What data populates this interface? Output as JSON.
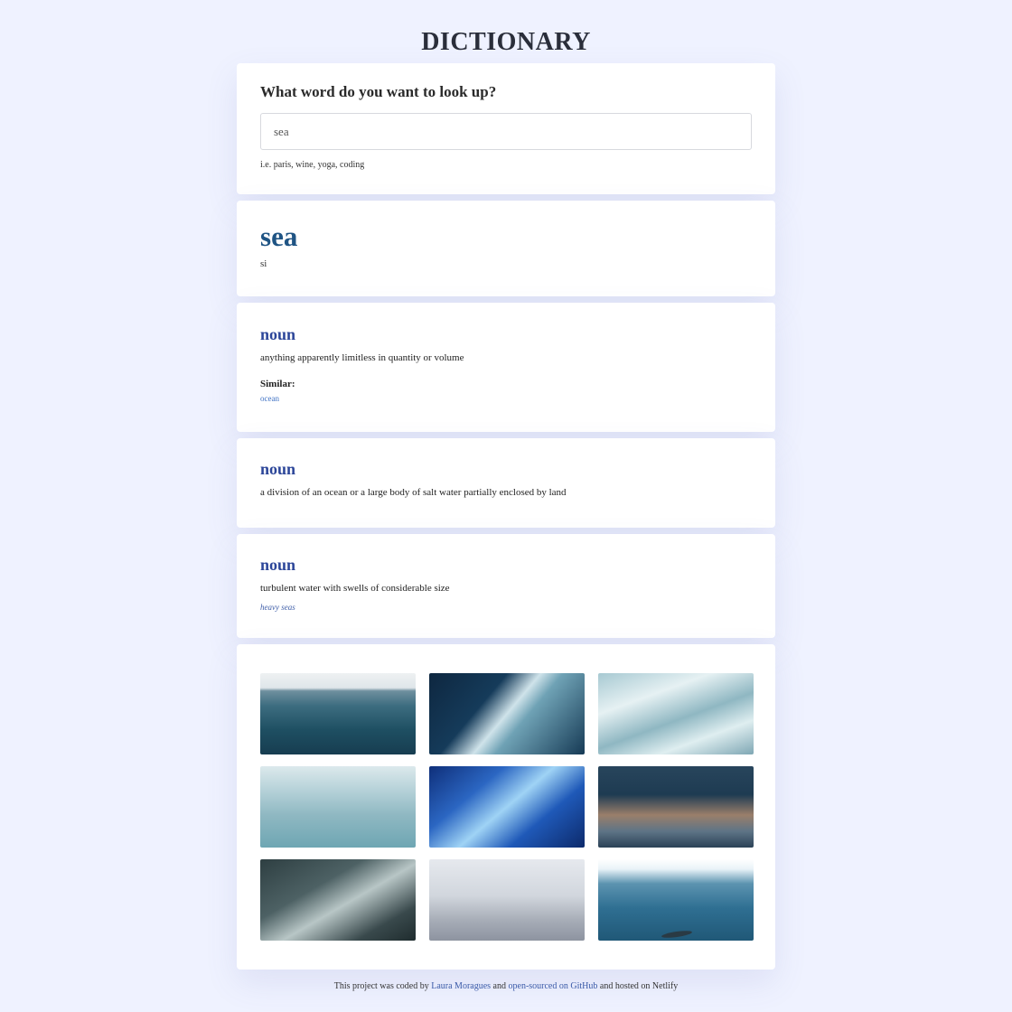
{
  "header": {
    "title": "DICTIONARY"
  },
  "search": {
    "heading": "What word do you want to look up?",
    "value": "sea",
    "hint": "i.e. paris, wine, yoga, coding"
  },
  "result": {
    "word": "sea",
    "phonetic": "si"
  },
  "meanings": [
    {
      "part_of_speech": "noun",
      "definition": "anything apparently limitless in quantity or volume",
      "similar_label": "Similar:",
      "synonyms": "ocean"
    },
    {
      "part_of_speech": "noun",
      "definition": "a division of an ocean or a large body of salt water partially enclosed by land"
    },
    {
      "part_of_speech": "noun",
      "definition": "turbulent water with swells of considerable size",
      "example": "heavy seas"
    }
  ],
  "photos": [
    {
      "icon": "ocean-horizon-photo"
    },
    {
      "icon": "crashing-wave-photo"
    },
    {
      "icon": "sea-foam-photo"
    },
    {
      "icon": "calm-water-photo"
    },
    {
      "icon": "blue-wave-photo"
    },
    {
      "icon": "wave-crest-photo"
    },
    {
      "icon": "stormy-sea-photo"
    },
    {
      "icon": "foggy-sea-photo"
    },
    {
      "icon": "underwater-shark-photo"
    }
  ],
  "footer": {
    "prefix": "This project was coded by ",
    "author": "Laura Moragues",
    "middle": " and ",
    "repo_link": "open-sourced on GitHub",
    "suffix": " and hosted on Netlify"
  }
}
